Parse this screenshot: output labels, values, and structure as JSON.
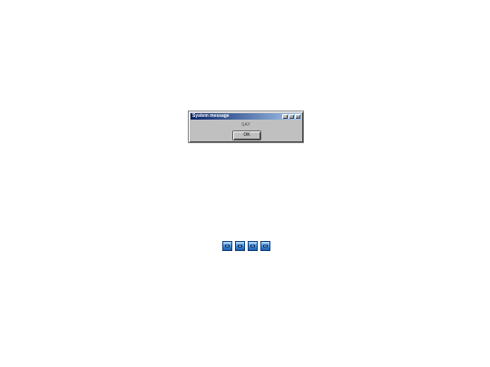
{
  "dialog": {
    "title": "System message",
    "message": "SAY",
    "ok_label": "OK",
    "minimize_glyph": "_",
    "maximize_glyph": "□",
    "close_glyph": "×"
  },
  "taskbar": {
    "icons": [
      "app-icon",
      "app-icon",
      "app-icon",
      "app-icon"
    ]
  },
  "colors": {
    "title_gradient_start": "#0a246a",
    "title_gradient_end": "#a6caf0",
    "dialog_face": "#c0c0c0",
    "icon_blue": "#4f9be0"
  }
}
